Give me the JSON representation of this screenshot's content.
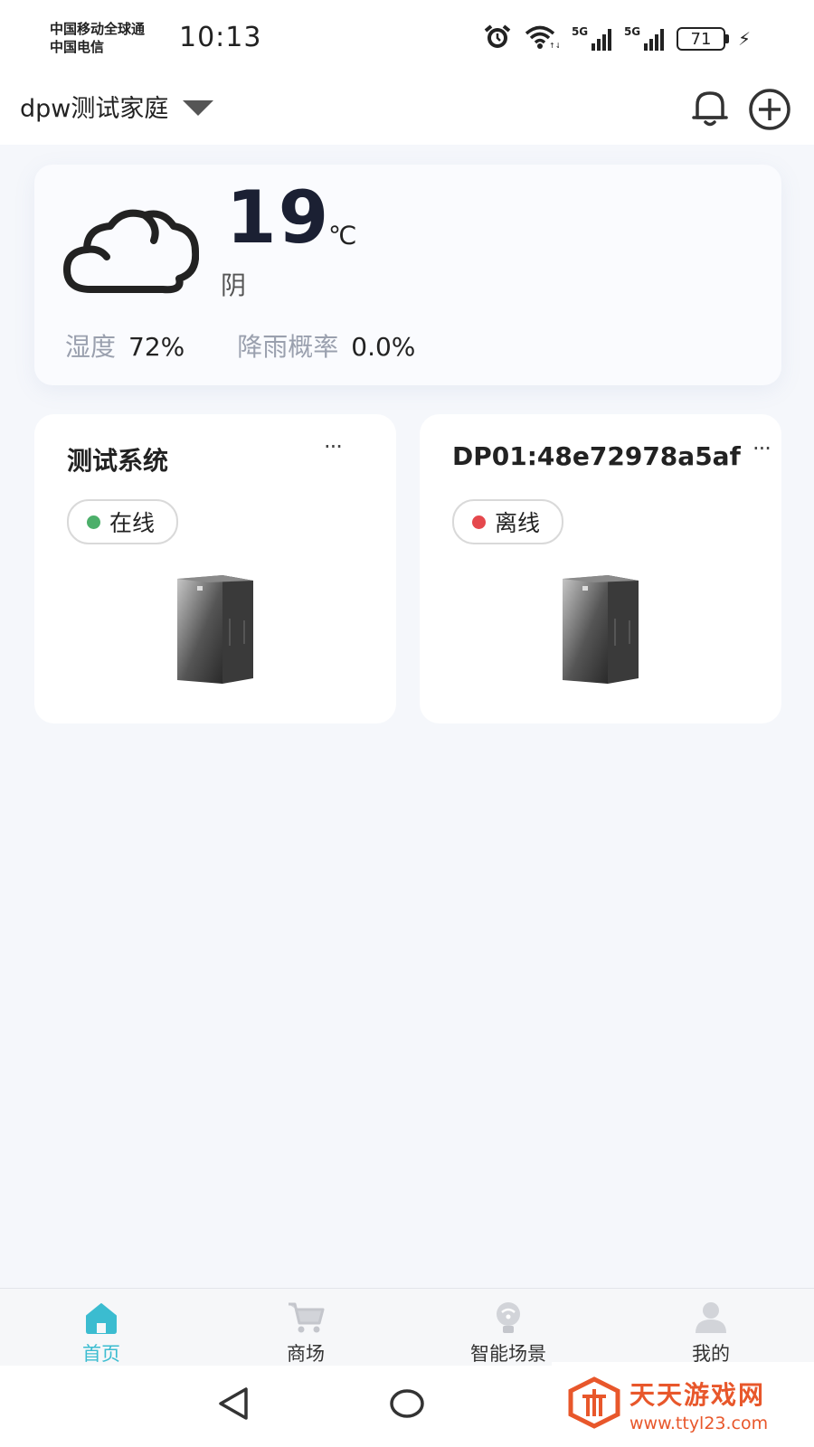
{
  "status_bar": {
    "carrier_1": "中国移动全球通",
    "carrier_2": "中国电信",
    "time": "10:13",
    "sim_1_network": "5G",
    "sim_2_network": "5G",
    "battery": "71",
    "icons": [
      "alarm-icon",
      "wifi-icon",
      "signal-icon",
      "battery-icon",
      "charging-icon"
    ]
  },
  "header": {
    "home_name": "dpw测试家庭",
    "icons": [
      "dropdown-caret-icon",
      "bell-icon",
      "add-circle-icon"
    ]
  },
  "weather": {
    "temperature": "19",
    "unit": "℃",
    "condition": "阴",
    "humidity_label": "湿度",
    "humidity_value": "72%",
    "rain_label": "降雨概率",
    "rain_value": "0.0%",
    "icon": "cloud-icon"
  },
  "devices": [
    {
      "name": "测试系统",
      "more": "···",
      "status": "在线",
      "status_color": "#4caf6a",
      "image": "cabinet-image"
    },
    {
      "name": "DP01:48e72978a5af",
      "more": "···",
      "status": "离线",
      "status_color": "#e5484d",
      "image": "cabinet-image"
    }
  ],
  "tab_bar": {
    "active_color": "#3bbcd0",
    "inactive_color": "#c4c6cc",
    "tabs": [
      {
        "label": "首页",
        "icon": "home-icon",
        "active": true
      },
      {
        "label": "商场",
        "icon": "cart-icon",
        "active": false
      },
      {
        "label": "智能场景",
        "icon": "smart-scene-icon",
        "active": false
      },
      {
        "label": "我的",
        "icon": "user-icon",
        "active": false
      }
    ]
  },
  "nav_bar": {
    "icons": [
      "back-triangle-icon",
      "home-circle-icon"
    ]
  },
  "watermark": {
    "title": "天天游戏网",
    "url": "www.ttyl23.com",
    "icon": "watermark-logo-icon"
  }
}
